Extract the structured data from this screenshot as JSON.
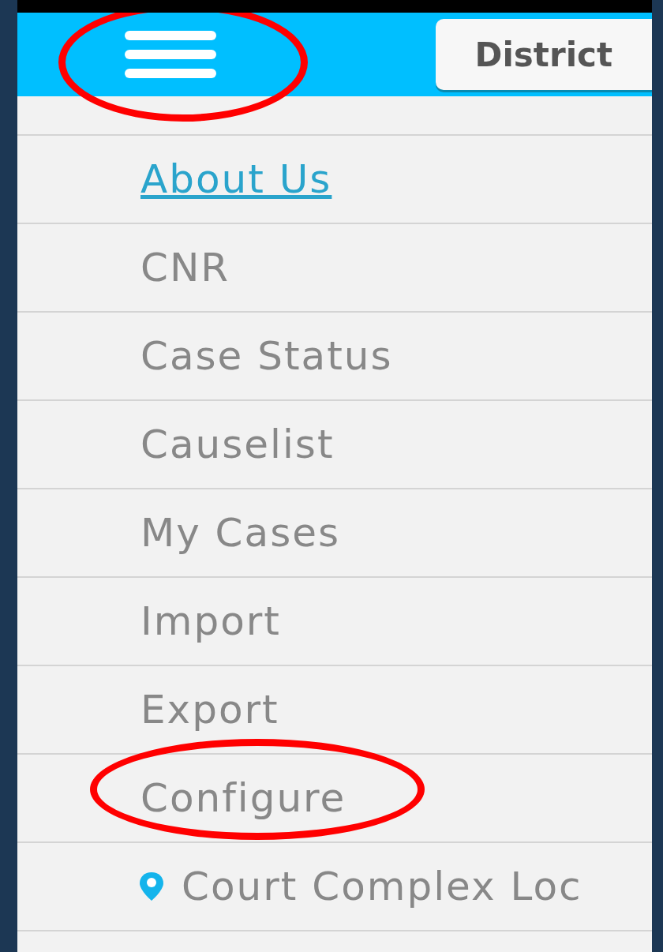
{
  "header": {
    "menu_button": {
      "highlighted": true
    },
    "district_button": {
      "label": "District"
    }
  },
  "menu": [
    {
      "label": "About Us",
      "kind": "link",
      "highlighted": false
    },
    {
      "label": "CNR",
      "kind": "item",
      "highlighted": false
    },
    {
      "label": "Case Status",
      "kind": "item",
      "highlighted": false
    },
    {
      "label": "Causelist",
      "kind": "item",
      "highlighted": false
    },
    {
      "label": "My Cases",
      "kind": "item",
      "highlighted": false
    },
    {
      "label": "Import",
      "kind": "item",
      "highlighted": false
    },
    {
      "label": "Export",
      "kind": "item",
      "highlighted": false
    },
    {
      "label": "Configure",
      "kind": "item",
      "highlighted": true
    },
    {
      "label": "Court Complex Loc",
      "kind": "location",
      "highlighted": false
    }
  ]
}
